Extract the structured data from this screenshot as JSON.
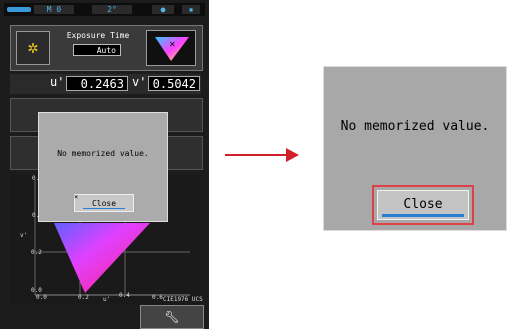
{
  "device": {
    "topbar": {
      "mode_label": "M 0",
      "angle_label": "2°",
      "icons": [
        "battery-icon",
        "memory-icon",
        "dot-icon",
        "sd-card-icon"
      ]
    },
    "exposure": {
      "label": "Exposure Time",
      "value": "Auto",
      "icon": "sun-icon"
    },
    "readout": {
      "u_label": "u'",
      "u_value": "0.2463",
      "v_label": "v'",
      "v_value": "0.5042"
    },
    "chart": {
      "y_ticks": [
        "0.",
        "0.",
        "0.2",
        "0.0"
      ],
      "y_label": "v'",
      "x_ticks": [
        "0.0",
        "0.2",
        "0.4",
        "0.6"
      ],
      "x_label": "u'",
      "chart_name": "CIE1976 UCS"
    },
    "tool_icon": "wrench-icon",
    "dialog": {
      "message": "No memorized value.",
      "close_label": "Close"
    }
  },
  "zoomed_dialog": {
    "message": "No memorized value.",
    "close_label": "Close"
  },
  "colors": {
    "highlight": "#e04048",
    "arrow": "#d0202a",
    "underline": "#2a7fd4"
  }
}
